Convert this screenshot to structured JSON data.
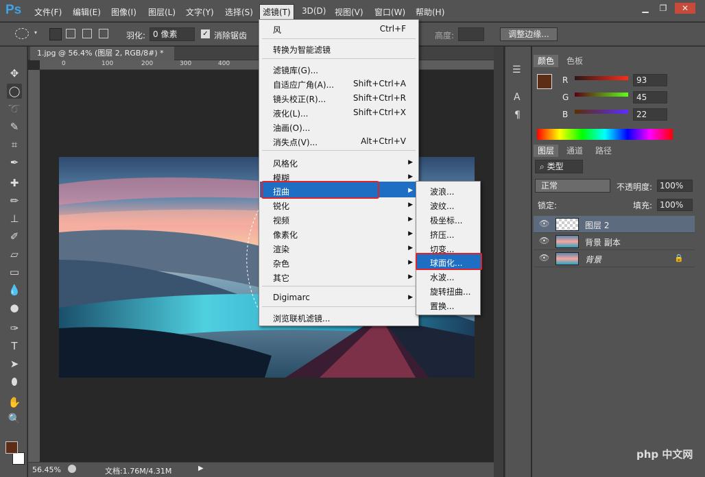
{
  "app": {
    "logo": "Ps"
  },
  "menubar": {
    "items": [
      "文件(F)",
      "编辑(E)",
      "图像(I)",
      "图层(L)",
      "文字(Y)",
      "选择(S)",
      "滤镜(T)",
      "3D(D)",
      "视图(V)",
      "窗口(W)",
      "帮助(H)"
    ],
    "active": "滤镜(T)"
  },
  "window_controls": {
    "minimize": "▁",
    "restore": "❐",
    "close": "✕"
  },
  "options": {
    "feather_label": "羽化:",
    "feather_value": "0 像素",
    "antialias_label": "消除锯齿",
    "height_label": "高度:",
    "refine_edge": "调整边缘..."
  },
  "document": {
    "tab_title": "1.jpg @ 56.4% (图层 2, RGB/8#) *",
    "close": "✕",
    "ruler_h": [
      "0",
      "100",
      "200",
      "300",
      "400"
    ],
    "ruler_v": [
      "0",
      "1 0 0",
      "1 5 0",
      "2 0 0",
      "2 5 0",
      "3 0 0",
      "3 5 0",
      "4 0 0",
      "4 5 0",
      "5 0 0"
    ],
    "zoom": "56.45%",
    "doc_info": "文档:1.76M/4.31M"
  },
  "filter_menu": {
    "items": [
      {
        "label": "风",
        "shortcut": "Ctrl+F"
      },
      {
        "label": "转换为智能滤镜",
        "shortcut": ""
      },
      {
        "label": "滤镜库(G)...",
        "shortcut": ""
      },
      {
        "label": "自适应广角(A)...",
        "shortcut": "Shift+Ctrl+A"
      },
      {
        "label": "镜头校正(R)...",
        "shortcut": "Shift+Ctrl+R"
      },
      {
        "label": "液化(L)...",
        "shortcut": "Shift+Ctrl+X"
      },
      {
        "label": "油画(O)...",
        "shortcut": ""
      },
      {
        "label": "消失点(V)...",
        "shortcut": "Alt+Ctrl+V"
      },
      {
        "label": "风格化",
        "shortcut": ""
      },
      {
        "label": "模糊",
        "shortcut": ""
      },
      {
        "label": "扭曲",
        "shortcut": ""
      },
      {
        "label": "锐化",
        "shortcut": ""
      },
      {
        "label": "视频",
        "shortcut": ""
      },
      {
        "label": "像素化",
        "shortcut": ""
      },
      {
        "label": "渲染",
        "shortcut": ""
      },
      {
        "label": "杂色",
        "shortcut": ""
      },
      {
        "label": "其它",
        "shortcut": ""
      },
      {
        "label": "Digimarc",
        "shortcut": ""
      },
      {
        "label": "浏览联机滤镜...",
        "shortcut": ""
      }
    ]
  },
  "distort_submenu": {
    "items": [
      "波浪...",
      "波纹...",
      "极坐标...",
      "挤压...",
      "切变...",
      "球面化...",
      "水波...",
      "旋转扭曲...",
      "置换..."
    ],
    "highlighted": "球面化..."
  },
  "color_panel": {
    "tabs": [
      "颜色",
      "色板"
    ],
    "r_label": "R",
    "r_value": "93",
    "g_label": "G",
    "g_value": "45",
    "b_label": "B",
    "b_value": "22",
    "foreground": "#5d2d16"
  },
  "layers_panel": {
    "tabs": [
      "图层",
      "通道",
      "路径"
    ],
    "filter_label": "类型",
    "blend_mode": "正常",
    "opacity_label": "不透明度:",
    "opacity_value": "100%",
    "lock_label": "锁定:",
    "fill_label": "填充:",
    "fill_value": "100%",
    "layers": [
      {
        "name": "图层 2"
      },
      {
        "name": "背景 副本"
      },
      {
        "name": "背景"
      }
    ]
  },
  "watermark": "php 中文网"
}
